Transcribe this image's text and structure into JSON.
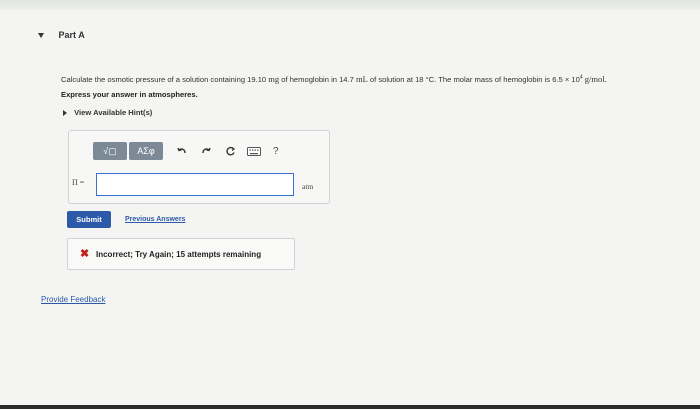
{
  "part": {
    "title": "Part A"
  },
  "question": {
    "text_before": "Calculate the osmotic pressure of a solution containing 19.10 ",
    "unit_mg": "mg",
    "text_mid": " of hemoglobin in 14.7 ",
    "unit_ml": "mL",
    "text_mid2": " of solution at 18 ",
    "deg_c": "°C",
    "text_mid3": ". The molar mass of hemoglobin is 6.5 × 10",
    "exponent": "4",
    "text_end": " g/mol."
  },
  "instruction": "Express your answer in atmospheres.",
  "hints": {
    "label": "View Available Hint(s)"
  },
  "toolbar": {
    "templates_label": "√▢",
    "symbols_label": "ΑΣφ",
    "help_label": "?"
  },
  "answer": {
    "variable": "Π =",
    "value": "",
    "unit": "atm"
  },
  "buttons": {
    "submit": "Submit",
    "previous_answers": "Previous Answers"
  },
  "feedback": {
    "message": "Incorrect; Try Again; 15 attempts remaining"
  },
  "footer": {
    "provide_feedback": "Provide Feedback"
  },
  "colors": {
    "accent": "#2d5aa8",
    "error": "#c0231f",
    "input_border": "#3a6fd8"
  }
}
